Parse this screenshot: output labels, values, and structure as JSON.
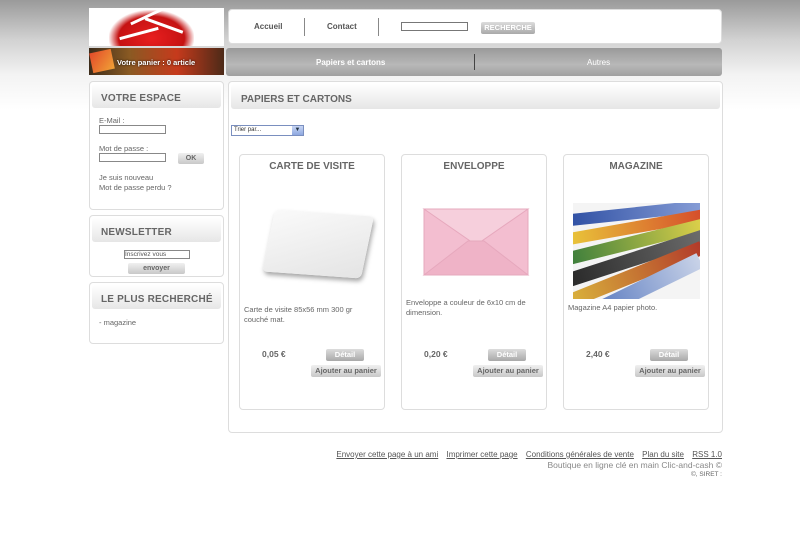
{
  "header": {
    "nav": [
      "Accueil",
      "Contact"
    ],
    "search_button": "RECHERCHE",
    "cart_text": "Votre panier : 0 article"
  },
  "categories": [
    "Papiers et cartons",
    "Autres"
  ],
  "espace": {
    "title": "VOTRE ESPACE",
    "email_label": "E-Mail :",
    "password_label": "Mot de passe :",
    "ok_button": "OK",
    "new_user_link": "Je suis nouveau",
    "forgot_link": "Mot de passe perdu ?"
  },
  "newsletter": {
    "title": "NEWSLETTER",
    "input_value": "Inscrivez vous",
    "button": "envoyer"
  },
  "popular": {
    "title": "LE PLUS RECHERCHÉ",
    "items": [
      "- magazine"
    ]
  },
  "main": {
    "title": "PAPIERS ET CARTONS",
    "sort_label": "Trier par..."
  },
  "products": [
    {
      "name": "CARTE DE VISITE",
      "description": " Carte de visite 85x56 mm 300 gr couché mat.",
      "price": "0,05 €",
      "detail": "Détail",
      "add": "Ajouter au panier"
    },
    {
      "name": "ENVELOPPE",
      "description": "Enveloppe a couleur de 6x10 cm de dimension.",
      "price": "0,20 €",
      "detail": "Détail",
      "add": "Ajouter au panier"
    },
    {
      "name": "MAGAZINE",
      "description": "Magazine A4 papier photo.",
      "price": "2,40 €",
      "detail": "Détail",
      "add": "Ajouter au panier"
    }
  ],
  "footer": {
    "links": [
      "Envoyer cette page à un ami",
      "Imprimer cette page",
      "Conditions générales de vente",
      "Plan du site",
      "RSS 1.0"
    ],
    "tagline": "Boutique en ligne clé en main Clic-and-cash ©",
    "siret": "©, SIRET :"
  }
}
